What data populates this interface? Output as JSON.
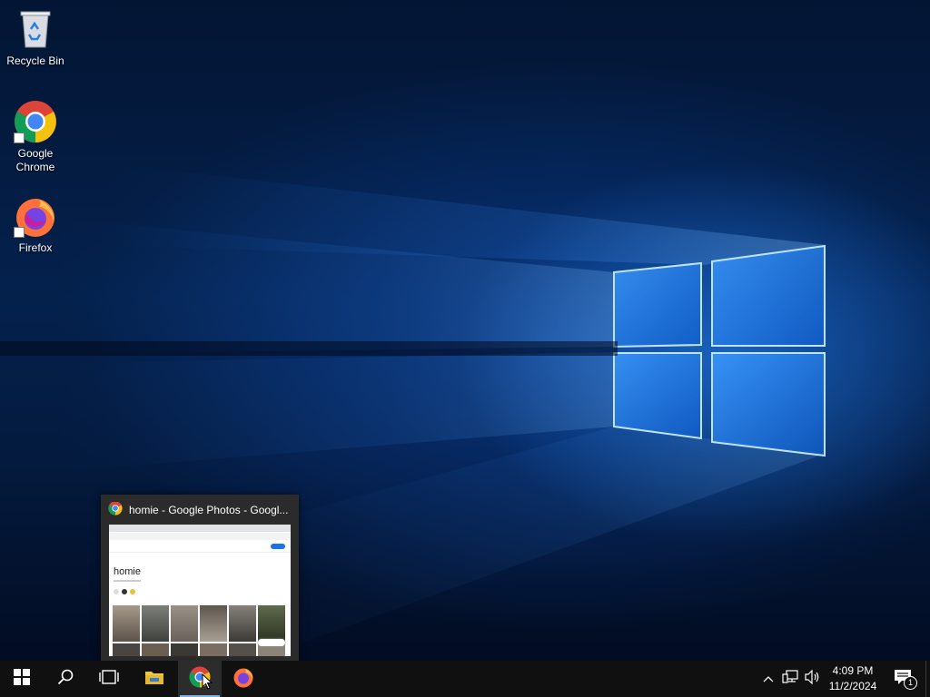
{
  "desktop": {
    "icons": [
      {
        "label": "Recycle Bin",
        "icon": "recycle-bin-icon"
      },
      {
        "label": "Google\nChrome",
        "icon": "chrome-icon"
      },
      {
        "label": "Firefox",
        "icon": "firefox-icon"
      }
    ]
  },
  "preview": {
    "window_title": "homie - Google Photos - Googl...",
    "album_title": "homie"
  },
  "taskbar": {
    "buttons": [
      {
        "name": "start",
        "icon": "windows-logo-icon"
      },
      {
        "name": "search",
        "icon": "search-icon"
      },
      {
        "name": "task-view",
        "icon": "task-view-icon"
      },
      {
        "name": "file-explorer",
        "icon": "folder-icon"
      },
      {
        "name": "chrome",
        "icon": "chrome-icon",
        "active": true
      },
      {
        "name": "firefox",
        "icon": "firefox-icon"
      }
    ],
    "tray": {
      "time": "4:09 PM",
      "date": "11/2/2024",
      "notification_count": "1"
    }
  },
  "colors": {
    "taskbar": "#101010",
    "accent_underline": "#7fb3e6",
    "wallpaper_glow": "#288cff"
  }
}
